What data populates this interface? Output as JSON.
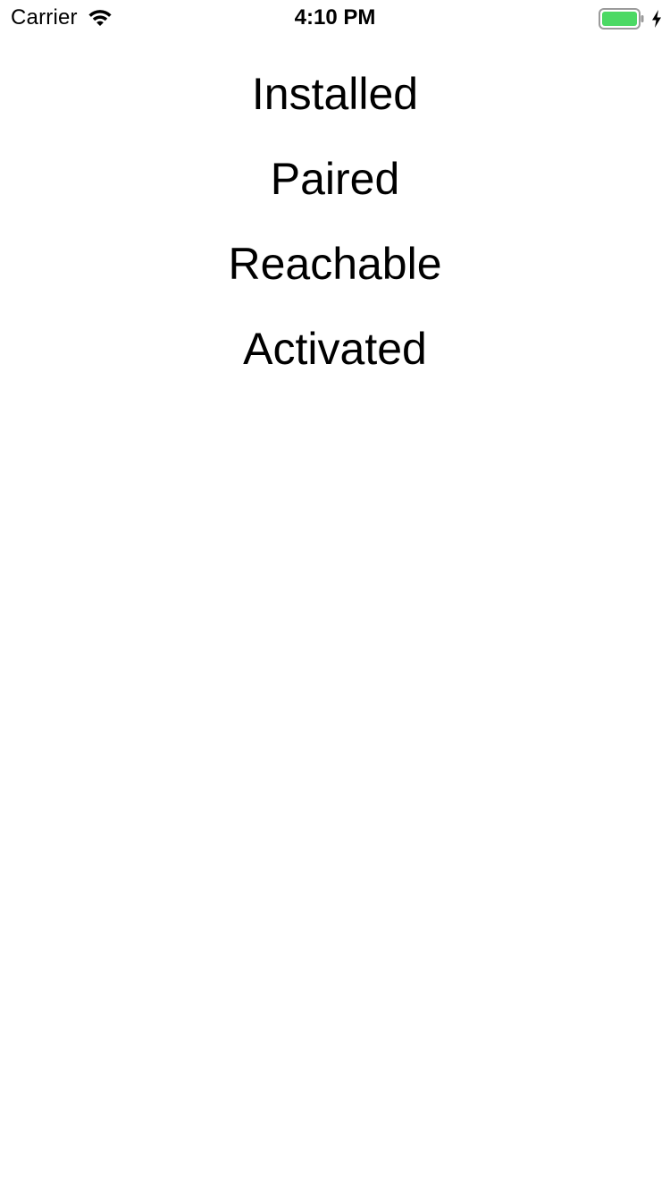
{
  "status_bar": {
    "carrier": "Carrier",
    "time": "4:10 PM",
    "wifi_icon": "wifi-icon",
    "battery_icon": "battery-icon",
    "charging_icon": "charging-bolt-icon",
    "battery_level": 1.0,
    "battery_color": "#4cd964"
  },
  "status_list": [
    {
      "label": "Installed"
    },
    {
      "label": "Paired"
    },
    {
      "label": "Reachable"
    },
    {
      "label": "Activated"
    }
  ]
}
